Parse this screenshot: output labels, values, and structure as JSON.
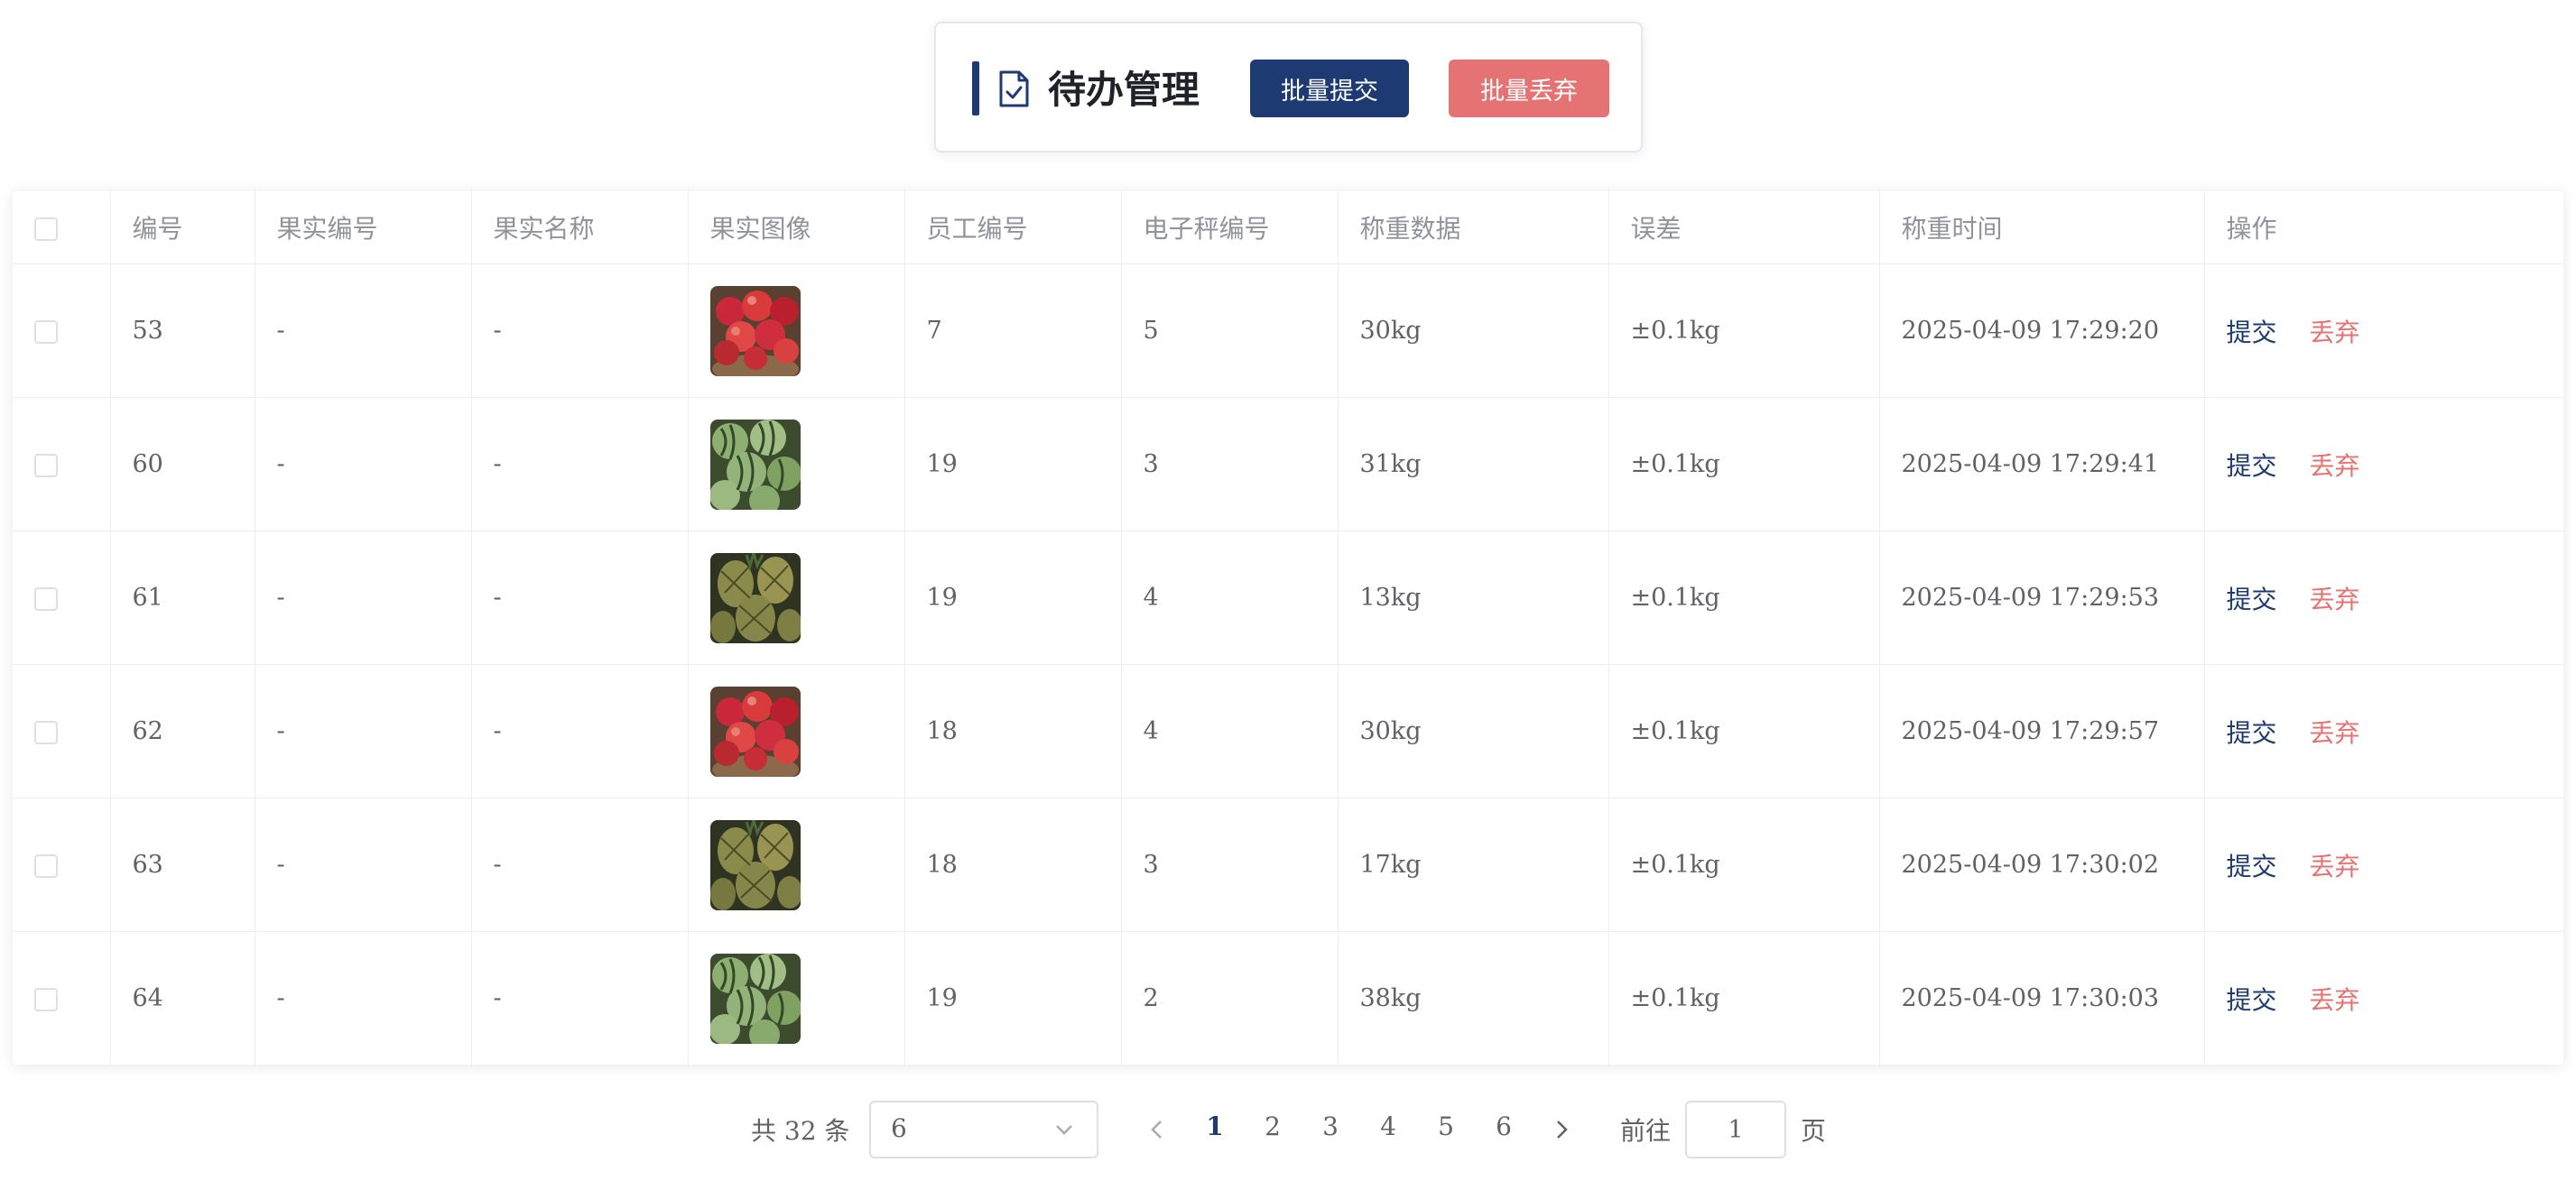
{
  "header": {
    "title": "待办管理",
    "batch_submit_label": "批量提交",
    "batch_discard_label": "批量丢弃",
    "icon": "document-check-icon"
  },
  "colors": {
    "primary": "#1e3a72",
    "danger": "#e57373"
  },
  "table": {
    "columns": [
      "编号",
      "果实编号",
      "果实名称",
      "果实图像",
      "员工编号",
      "电子秤编号",
      "称重数据",
      "误差",
      "称重时间",
      "操作"
    ],
    "actions": {
      "submit": "提交",
      "discard": "丢弃"
    },
    "rows": [
      {
        "id": "53",
        "fruit_no": "-",
        "fruit_name": "-",
        "image": "apples",
        "employee_no": "7",
        "scale_no": "5",
        "weight": "30kg",
        "error": "±0.1kg",
        "time": "2025-04-09 17:29:20"
      },
      {
        "id": "60",
        "fruit_no": "-",
        "fruit_name": "-",
        "image": "watermelons",
        "employee_no": "19",
        "scale_no": "3",
        "weight": "31kg",
        "error": "±0.1kg",
        "time": "2025-04-09 17:29:41"
      },
      {
        "id": "61",
        "fruit_no": "-",
        "fruit_name": "-",
        "image": "pineapples",
        "employee_no": "19",
        "scale_no": "4",
        "weight": "13kg",
        "error": "±0.1kg",
        "time": "2025-04-09 17:29:53"
      },
      {
        "id": "62",
        "fruit_no": "-",
        "fruit_name": "-",
        "image": "apples",
        "employee_no": "18",
        "scale_no": "4",
        "weight": "30kg",
        "error": "±0.1kg",
        "time": "2025-04-09 17:29:57"
      },
      {
        "id": "63",
        "fruit_no": "-",
        "fruit_name": "-",
        "image": "pineapples",
        "employee_no": "18",
        "scale_no": "3",
        "weight": "17kg",
        "error": "±0.1kg",
        "time": "2025-04-09 17:30:02"
      },
      {
        "id": "64",
        "fruit_no": "-",
        "fruit_name": "-",
        "image": "watermelons",
        "employee_no": "19",
        "scale_no": "2",
        "weight": "38kg",
        "error": "±0.1kg",
        "time": "2025-04-09 17:30:03"
      }
    ]
  },
  "pagination": {
    "total_text": "共 32 条",
    "page_size": "6",
    "pages": [
      "1",
      "2",
      "3",
      "4",
      "5",
      "6"
    ],
    "current_page": "1",
    "goto_label": "前往",
    "goto_value": "1",
    "page_unit": "页"
  }
}
